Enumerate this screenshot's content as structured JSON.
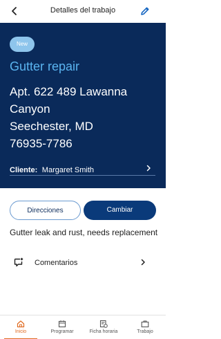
{
  "topbar": {
    "title": "Detalles del trabajo",
    "back_icon": "back-arrow-icon",
    "edit_icon": "pencil-icon"
  },
  "hero": {
    "badge": "New",
    "job_title": "Gutter repair",
    "address_line1": "Apt. 622 489 Lawanna",
    "address_line2": "Canyon",
    "address_line3": "Seechester, MD",
    "address_line4": "76935-7786",
    "client_label": "Cliente:",
    "client_name": "Margaret  Smith"
  },
  "actions": {
    "directions_label": "Direcciones",
    "change_label": "Cambiar"
  },
  "description": "Gutter leak and rust, needs replacement",
  "comments": {
    "label": "Comentarios"
  },
  "bottom_nav": {
    "items": [
      {
        "label": "Inicio",
        "icon": "home-icon"
      },
      {
        "label": "Programar",
        "icon": "calendar-icon"
      },
      {
        "label": "Ficha horaria",
        "icon": "timesheet-icon"
      },
      {
        "label": "Trabajo",
        "icon": "briefcase-icon"
      }
    ]
  },
  "colors": {
    "hero_bg": "#0a2a5a",
    "title_accent": "#5ab4f0",
    "badge_bg": "#8ec5ec",
    "primary_button": "#0a3a7a",
    "active_nav": "#e06a20"
  }
}
